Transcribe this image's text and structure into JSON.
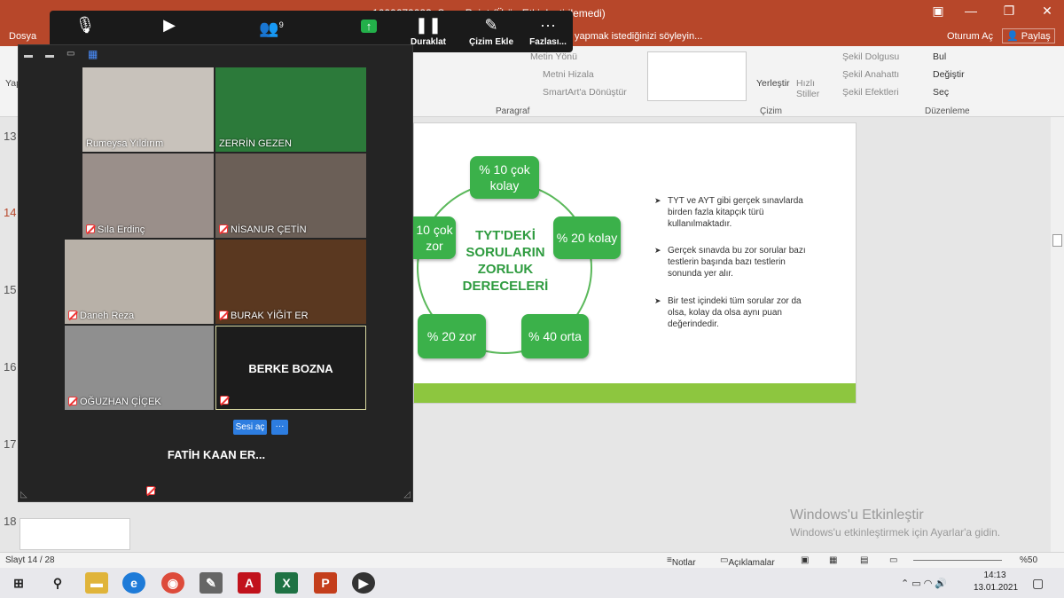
{
  "app": {
    "title_suffix": "1600672023_S... ...Point (Ürün Etkinleştirilemedi)",
    "tab_dosya": "Dosya",
    "search_hint": "yapmak istediğinizi söyleyin...",
    "share": "Paylaş",
    "open": "Oturum Aç"
  },
  "zoom_toolbar": {
    "participants_count": "9",
    "pause": "Duraklat",
    "annotate": "Çizim Ekle",
    "more": "Fazlası..."
  },
  "ribbon": {
    "paragraph_label": "Paragraf",
    "drawing_label": "Çizim",
    "editing_label": "Düzenleme",
    "text_direction": "Metin Yönü",
    "align_text": "Metni Hizala",
    "smartart": "SmartArt'a Dönüştür",
    "arrange": "Yerleştir",
    "quick_styles": "Hızlı Stiller",
    "shape_fill": "Şekil Dolgusu",
    "shape_outline": "Şekil Anahattı",
    "shape_effects": "Şekil Efektleri",
    "find": "Bul",
    "replace": "Değiştir",
    "select": "Seç",
    "yap": "Yap"
  },
  "slide_numbers": [
    "13",
    "14",
    "15",
    "16",
    "17",
    "18"
  ],
  "slide": {
    "center_text": [
      "TYT'DEKİ",
      "SORULARIN",
      "ZORLUK",
      "DERECELERİ"
    ],
    "nodes": [
      "% 10 çok kolay",
      "% 20 kolay",
      "% 40 orta",
      "% 20 zor",
      "10 çok zor"
    ],
    "bullets": [
      "TYT ve AYT gibi gerçek sınavlarda birden fazla kitapçık türü kullanılmaktadır.",
      "Gerçek sınavda bu zor sorular bazı testlerin başında bazı testlerin sonunda yer alır.",
      "Bir test içindeki tüm sorular zor da olsa, kolay da olsa aynı puan değerindedir."
    ]
  },
  "participants": [
    {
      "name": "Rumeysa Yıldırım",
      "muted": false,
      "bg": "#c8c2bb"
    },
    {
      "name": "ZERRİN GEZEN",
      "muted": false,
      "bg": "#2c7a3a"
    },
    {
      "name": "Sıla Erdinç",
      "muted": true,
      "bg": "#9a8f8a"
    },
    {
      "name": "NİSANUR ÇETİN",
      "muted": true,
      "bg": "#6b5f57"
    },
    {
      "name": "Daneh Reza",
      "muted": true,
      "bg": "#b8b1a8"
    },
    {
      "name": "BURAK YİĞİT ER",
      "muted": true,
      "bg": "#5a3820"
    },
    {
      "name": "OĞUZHAN ÇİÇEK",
      "muted": true,
      "bg": "#8f8f8f"
    },
    {
      "name": "BERKE BOZNA",
      "muted": true,
      "bg": "#1c1c1c"
    },
    {
      "name": "FATİH KAAN ER...",
      "muted": true,
      "bg": "#242424"
    }
  ],
  "unmute_btn": "Sesi aç",
  "status": {
    "slide": "Slayt 14 / 28",
    "notes": "Notlar",
    "comments": "Açıklamalar",
    "zoom": "%50"
  },
  "watermark": {
    "line1": "Windows'u Etkinleştir",
    "line2": "Windows'u etkinleştirmek için Ayarlar'a gidin."
  },
  "taskbar": {
    "time": "14:13",
    "date": "13.01.2021"
  },
  "colors": {
    "accent": "#b7472a",
    "green": "#3bb14a"
  }
}
